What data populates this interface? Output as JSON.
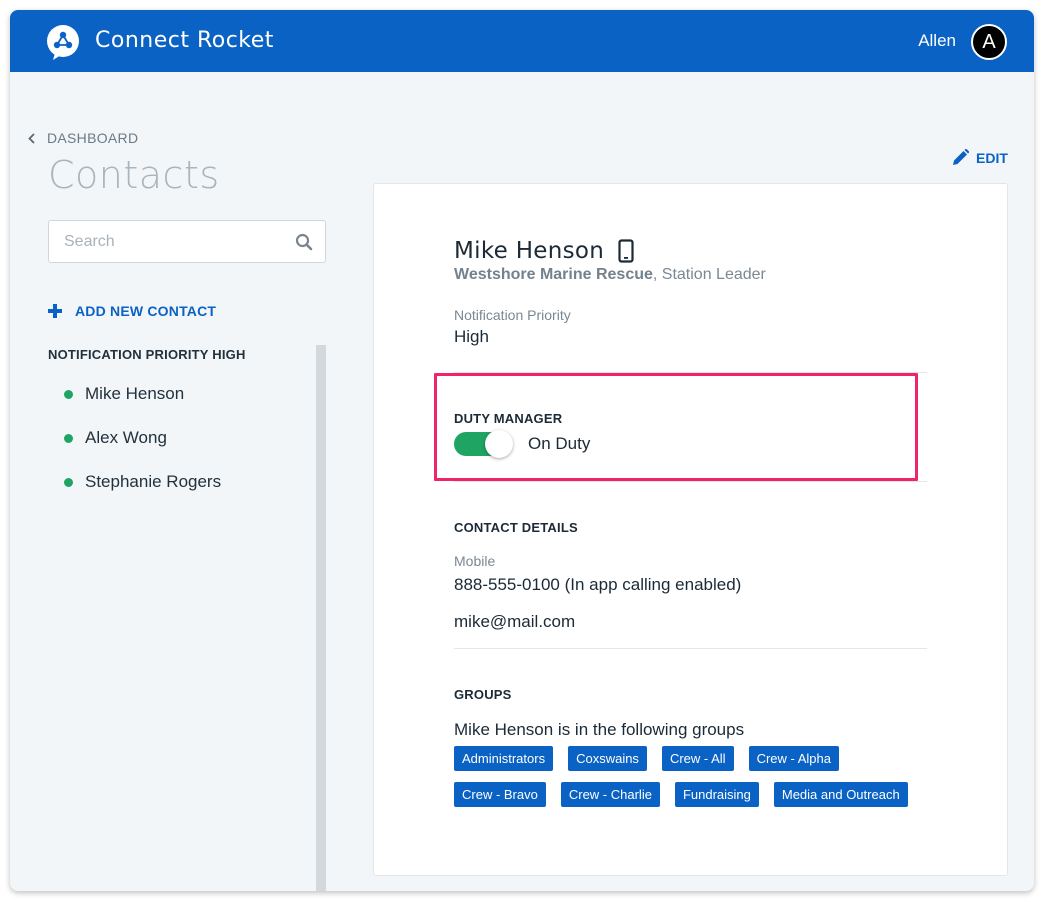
{
  "app": {
    "title": "Connect Rocket",
    "user_name": "Allen",
    "avatar_initial": "A",
    "brand_color": "#0a62c4"
  },
  "sidebar": {
    "back_label": "DASHBOARD",
    "page_title": "Contacts",
    "search_placeholder": "Search",
    "add_contact_label": "ADD NEW CONTACT",
    "group_heading": "NOTIFICATION PRIORITY HIGH",
    "contacts": [
      {
        "name": "Mike Henson",
        "status_color": "#1fa463"
      },
      {
        "name": "Alex Wong",
        "status_color": "#1fa463"
      },
      {
        "name": "Stephanie Rogers",
        "status_color": "#1fa463"
      }
    ]
  },
  "detail": {
    "edit_label": "EDIT",
    "name": "Mike Henson",
    "device_icon": "mobile-phone-icon",
    "organization": "Westshore Marine Rescue",
    "role": ", Station Leader",
    "priority_label": "Notification Priority",
    "priority_value": "High",
    "duty_heading": "DUTY MANAGER",
    "duty_on": true,
    "duty_status": "On Duty",
    "contact_heading": "CONTACT DETAILS",
    "mobile_label": "Mobile",
    "mobile_value": "888-555-0100 (In app calling enabled)",
    "email": "mike@mail.com",
    "groups_heading": "GROUPS",
    "groups_intro": "Mike Henson is in the following groups",
    "groups": [
      "Administrators",
      "Coxswains",
      "Crew - All",
      "Crew - Alpha",
      "Crew - Bravo",
      "Crew - Charlie",
      "Fundraising",
      "Media and Outreach"
    ],
    "highlight_color": "#ef2469",
    "toggle_color": "#1fa463"
  }
}
